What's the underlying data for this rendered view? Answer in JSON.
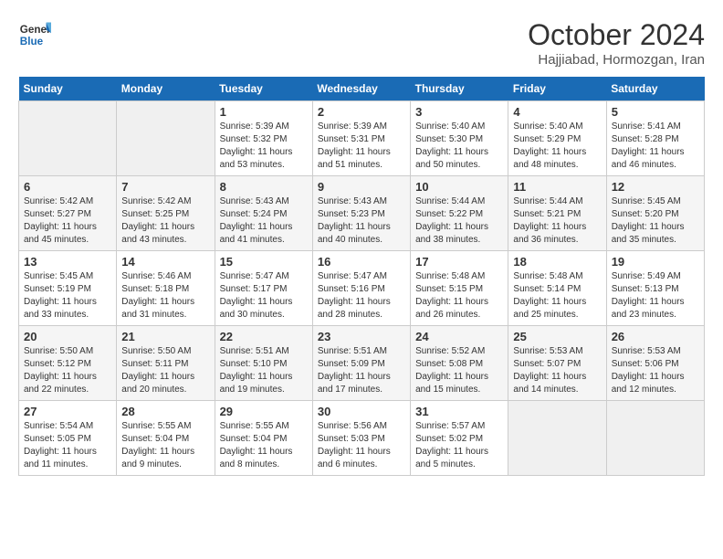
{
  "header": {
    "logo_line1": "General",
    "logo_line2": "Blue",
    "month": "October 2024",
    "location": "Hajjiabad, Hormozgan, Iran"
  },
  "weekdays": [
    "Sunday",
    "Monday",
    "Tuesday",
    "Wednesday",
    "Thursday",
    "Friday",
    "Saturday"
  ],
  "weeks": [
    [
      {
        "day": "",
        "info": ""
      },
      {
        "day": "",
        "info": ""
      },
      {
        "day": "1",
        "info": "Sunrise: 5:39 AM\nSunset: 5:32 PM\nDaylight: 11 hours\nand 53 minutes."
      },
      {
        "day": "2",
        "info": "Sunrise: 5:39 AM\nSunset: 5:31 PM\nDaylight: 11 hours\nand 51 minutes."
      },
      {
        "day": "3",
        "info": "Sunrise: 5:40 AM\nSunset: 5:30 PM\nDaylight: 11 hours\nand 50 minutes."
      },
      {
        "day": "4",
        "info": "Sunrise: 5:40 AM\nSunset: 5:29 PM\nDaylight: 11 hours\nand 48 minutes."
      },
      {
        "day": "5",
        "info": "Sunrise: 5:41 AM\nSunset: 5:28 PM\nDaylight: 11 hours\nand 46 minutes."
      }
    ],
    [
      {
        "day": "6",
        "info": "Sunrise: 5:42 AM\nSunset: 5:27 PM\nDaylight: 11 hours\nand 45 minutes."
      },
      {
        "day": "7",
        "info": "Sunrise: 5:42 AM\nSunset: 5:25 PM\nDaylight: 11 hours\nand 43 minutes."
      },
      {
        "day": "8",
        "info": "Sunrise: 5:43 AM\nSunset: 5:24 PM\nDaylight: 11 hours\nand 41 minutes."
      },
      {
        "day": "9",
        "info": "Sunrise: 5:43 AM\nSunset: 5:23 PM\nDaylight: 11 hours\nand 40 minutes."
      },
      {
        "day": "10",
        "info": "Sunrise: 5:44 AM\nSunset: 5:22 PM\nDaylight: 11 hours\nand 38 minutes."
      },
      {
        "day": "11",
        "info": "Sunrise: 5:44 AM\nSunset: 5:21 PM\nDaylight: 11 hours\nand 36 minutes."
      },
      {
        "day": "12",
        "info": "Sunrise: 5:45 AM\nSunset: 5:20 PM\nDaylight: 11 hours\nand 35 minutes."
      }
    ],
    [
      {
        "day": "13",
        "info": "Sunrise: 5:45 AM\nSunset: 5:19 PM\nDaylight: 11 hours\nand 33 minutes."
      },
      {
        "day": "14",
        "info": "Sunrise: 5:46 AM\nSunset: 5:18 PM\nDaylight: 11 hours\nand 31 minutes."
      },
      {
        "day": "15",
        "info": "Sunrise: 5:47 AM\nSunset: 5:17 PM\nDaylight: 11 hours\nand 30 minutes."
      },
      {
        "day": "16",
        "info": "Sunrise: 5:47 AM\nSunset: 5:16 PM\nDaylight: 11 hours\nand 28 minutes."
      },
      {
        "day": "17",
        "info": "Sunrise: 5:48 AM\nSunset: 5:15 PM\nDaylight: 11 hours\nand 26 minutes."
      },
      {
        "day": "18",
        "info": "Sunrise: 5:48 AM\nSunset: 5:14 PM\nDaylight: 11 hours\nand 25 minutes."
      },
      {
        "day": "19",
        "info": "Sunrise: 5:49 AM\nSunset: 5:13 PM\nDaylight: 11 hours\nand 23 minutes."
      }
    ],
    [
      {
        "day": "20",
        "info": "Sunrise: 5:50 AM\nSunset: 5:12 PM\nDaylight: 11 hours\nand 22 minutes."
      },
      {
        "day": "21",
        "info": "Sunrise: 5:50 AM\nSunset: 5:11 PM\nDaylight: 11 hours\nand 20 minutes."
      },
      {
        "day": "22",
        "info": "Sunrise: 5:51 AM\nSunset: 5:10 PM\nDaylight: 11 hours\nand 19 minutes."
      },
      {
        "day": "23",
        "info": "Sunrise: 5:51 AM\nSunset: 5:09 PM\nDaylight: 11 hours\nand 17 minutes."
      },
      {
        "day": "24",
        "info": "Sunrise: 5:52 AM\nSunset: 5:08 PM\nDaylight: 11 hours\nand 15 minutes."
      },
      {
        "day": "25",
        "info": "Sunrise: 5:53 AM\nSunset: 5:07 PM\nDaylight: 11 hours\nand 14 minutes."
      },
      {
        "day": "26",
        "info": "Sunrise: 5:53 AM\nSunset: 5:06 PM\nDaylight: 11 hours\nand 12 minutes."
      }
    ],
    [
      {
        "day": "27",
        "info": "Sunrise: 5:54 AM\nSunset: 5:05 PM\nDaylight: 11 hours\nand 11 minutes."
      },
      {
        "day": "28",
        "info": "Sunrise: 5:55 AM\nSunset: 5:04 PM\nDaylight: 11 hours\nand 9 minutes."
      },
      {
        "day": "29",
        "info": "Sunrise: 5:55 AM\nSunset: 5:04 PM\nDaylight: 11 hours\nand 8 minutes."
      },
      {
        "day": "30",
        "info": "Sunrise: 5:56 AM\nSunset: 5:03 PM\nDaylight: 11 hours\nand 6 minutes."
      },
      {
        "day": "31",
        "info": "Sunrise: 5:57 AM\nSunset: 5:02 PM\nDaylight: 11 hours\nand 5 minutes."
      },
      {
        "day": "",
        "info": ""
      },
      {
        "day": "",
        "info": ""
      }
    ]
  ]
}
